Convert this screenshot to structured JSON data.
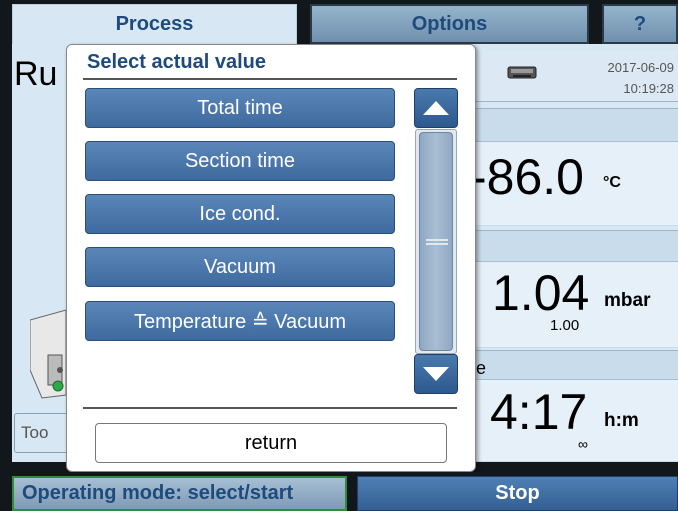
{
  "tabs": {
    "process": "Process",
    "options": "Options",
    "help": "?"
  },
  "background": {
    "title_partial": "Ru",
    "date": "2017-06-09",
    "time": "10:19:28",
    "temperature": {
      "value": "-86.0",
      "unit": "°C"
    },
    "vacuum": {
      "value": "1.04",
      "unit": "mbar",
      "setpoint": "1.00"
    },
    "section_label_partial": "e",
    "time_remaining": {
      "value": "4:17",
      "unit": "h:m",
      "extra": "∞"
    },
    "tool_button_partial": "Too"
  },
  "dialog": {
    "title": "Select actual value",
    "options": [
      "Total time",
      "Section time",
      "Ice cond.",
      "Vacuum",
      "Temperature ≙ Vacuum"
    ],
    "return_label": "return"
  },
  "footer": {
    "mode_label": "Operating mode: select/start",
    "stop_label": "Stop"
  },
  "colors": {
    "accent": "#1e4a7c",
    "button_blue": "#3e6a9f",
    "panel_bg": "#d7e7f3",
    "frame": "#12171c"
  }
}
